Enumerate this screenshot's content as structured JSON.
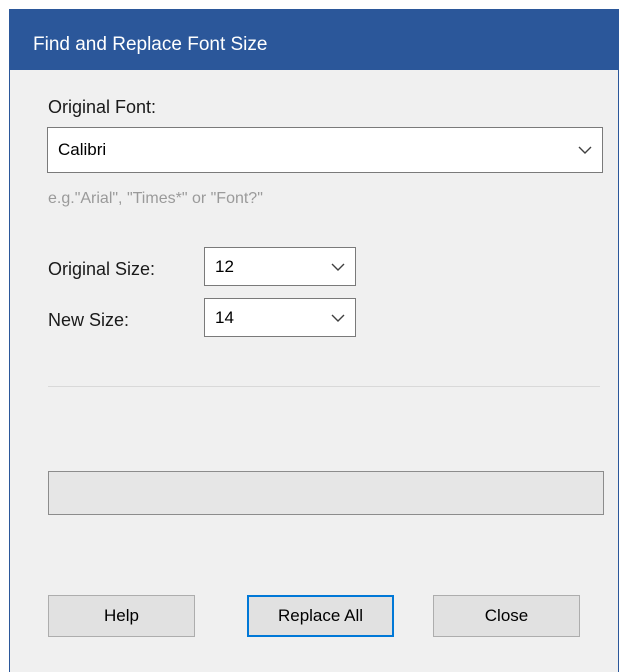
{
  "window": {
    "title": "Find and Replace Font Size"
  },
  "original_font": {
    "label": "Original Font:",
    "value": "Calibri",
    "hint": "e.g.\"Arial\",  \"Times*\" or \"Font?\""
  },
  "original_size": {
    "label": "Original Size:",
    "value": "12"
  },
  "new_size": {
    "label": "New Size:",
    "value": "14"
  },
  "progress": {
    "value_percent": 0
  },
  "buttons": {
    "help": "Help",
    "replace_all": "Replace All",
    "close": "Close"
  },
  "colors": {
    "titlebar": "#2b579a",
    "dialog_bg": "#f0f0f0",
    "hint_text": "#9a9a9a",
    "default_button_border": "#0078d7"
  }
}
